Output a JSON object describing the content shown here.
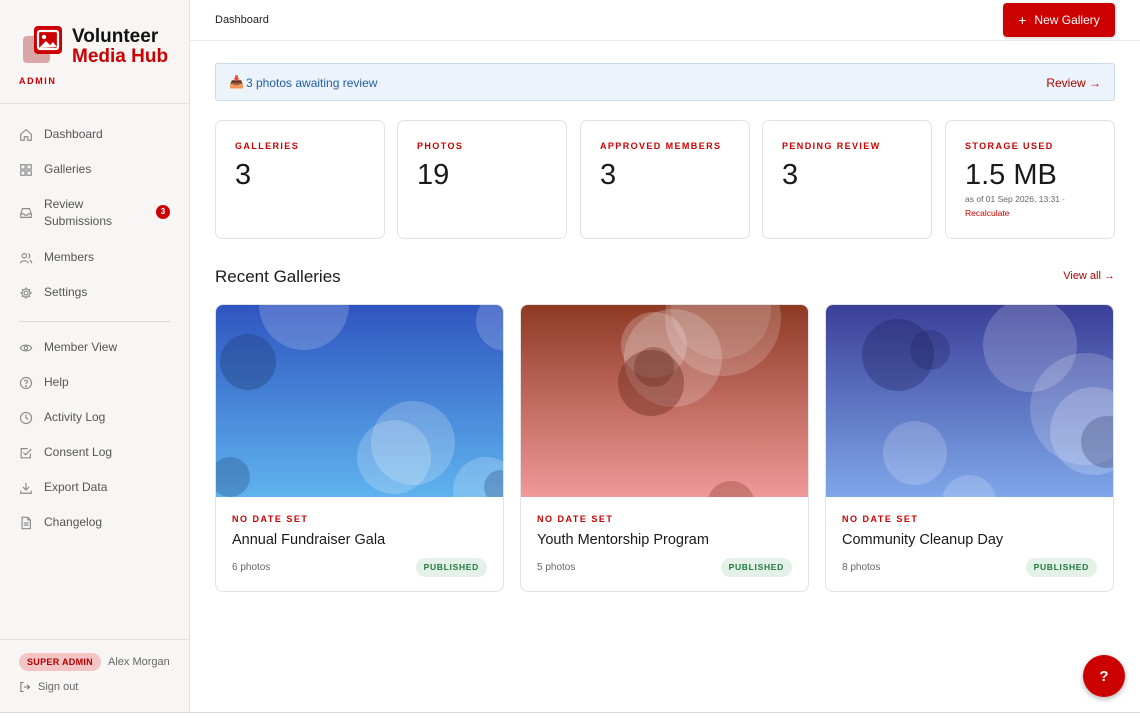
{
  "brand": {
    "name_line1": "Volunteer",
    "name_line2": "Media Hub",
    "role": "ADMIN"
  },
  "nav": {
    "dashboard": "Dashboard",
    "galleries": "Galleries",
    "review_line1": "Review",
    "review_line2": "Submissions",
    "review_badge": "3",
    "members": "Members",
    "settings": "Settings",
    "member_view": "Member View",
    "help": "Help",
    "activity_log": "Activity Log",
    "consent_log": "Consent Log",
    "export_data": "Export Data",
    "changelog": "Changelog"
  },
  "user": {
    "role_badge": "SUPER ADMIN",
    "name": "Alex Morgan",
    "sign_out": "Sign out"
  },
  "header": {
    "breadcrumb": "Dashboard",
    "new_gallery": "New Gallery",
    "new_gallery_icon": "+"
  },
  "alert": {
    "icon": "📥",
    "text": "3 photos awaiting review",
    "link": "Review →"
  },
  "stats": [
    {
      "label": "GALLERIES",
      "value": "3"
    },
    {
      "label": "PHOTOS",
      "value": "19"
    },
    {
      "label": "APPROVED MEMBERS",
      "value": "3"
    },
    {
      "label": "PENDING REVIEW",
      "value": "3"
    },
    {
      "label": "STORAGE USED",
      "value": "1.5 MB",
      "note": "as of 01 Sep 2026, 13:31 ·",
      "link": "Recalculate"
    }
  ],
  "recent": {
    "title": "Recent Galleries",
    "view_all": "View all →",
    "galleries": [
      {
        "date": "NO DATE SET",
        "title": "Annual Fundraiser Gala",
        "count": "6 photos",
        "status": "PUBLISHED",
        "colors": [
          "#2f55c0",
          "#5fb3ee"
        ]
      },
      {
        "date": "NO DATE SET",
        "title": "Youth Mentorship Program",
        "count": "5 photos",
        "status": "PUBLISHED",
        "colors": [
          "#8e3a24",
          "#f0999a"
        ]
      },
      {
        "date": "NO DATE SET",
        "title": "Community Cleanup Day",
        "count": "8 photos",
        "status": "PUBLISHED",
        "colors": [
          "#3b3f98",
          "#7fa7ea"
        ]
      }
    ]
  },
  "help_fab": "?",
  "colors": {
    "accent": "#cc0000",
    "published_bg": "#e4f1e8",
    "published_text": "#1e7a3d",
    "alert_bg": "#edf3fa",
    "alert_text": "#1f5fa8"
  }
}
